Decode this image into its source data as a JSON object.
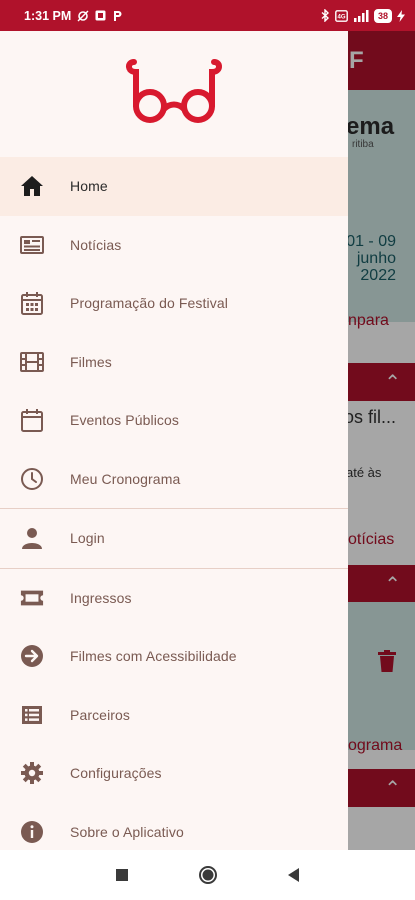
{
  "status_bar": {
    "time": "1:31 PM",
    "battery": "38"
  },
  "background": {
    "header_letter": "F",
    "banner_title": "ema",
    "banner_sub": "ritiba",
    "banner_dates_1": "01 - 09",
    "banner_dates_2": "junho",
    "banner_dates_3": "2022",
    "link_parceiros": "npara",
    "section_text": "os fil...",
    "small_text": "até às",
    "link_noticias": "otícias",
    "link_programa": "ograma"
  },
  "drawer": {
    "logo_alt": "bd",
    "items": [
      {
        "label": "Home",
        "icon": "home-icon"
      },
      {
        "label": "Notícias",
        "icon": "newspaper-icon"
      },
      {
        "label": "Programação do Festival",
        "icon": "calendar-grid-icon"
      },
      {
        "label": "Filmes",
        "icon": "film-icon"
      },
      {
        "label": "Eventos Públicos",
        "icon": "calendar-icon"
      },
      {
        "label": "Meu Cronograma",
        "icon": "clock-icon"
      },
      {
        "label": "Login",
        "icon": "person-icon"
      },
      {
        "label": "Ingressos",
        "icon": "ticket-icon"
      },
      {
        "label": "Filmes com Acessibilidade",
        "icon": "arrow-right-circle-icon"
      },
      {
        "label": "Parceiros",
        "icon": "list-icon"
      },
      {
        "label": "Configurações",
        "icon": "gear-icon"
      },
      {
        "label": "Sobre o Aplicativo",
        "icon": "info-icon"
      }
    ]
  },
  "colors": {
    "brand": "#b0122b",
    "icon": "#7a5a52",
    "drawer_bg": "#fdf6f4",
    "active_bg": "#fbece4"
  }
}
